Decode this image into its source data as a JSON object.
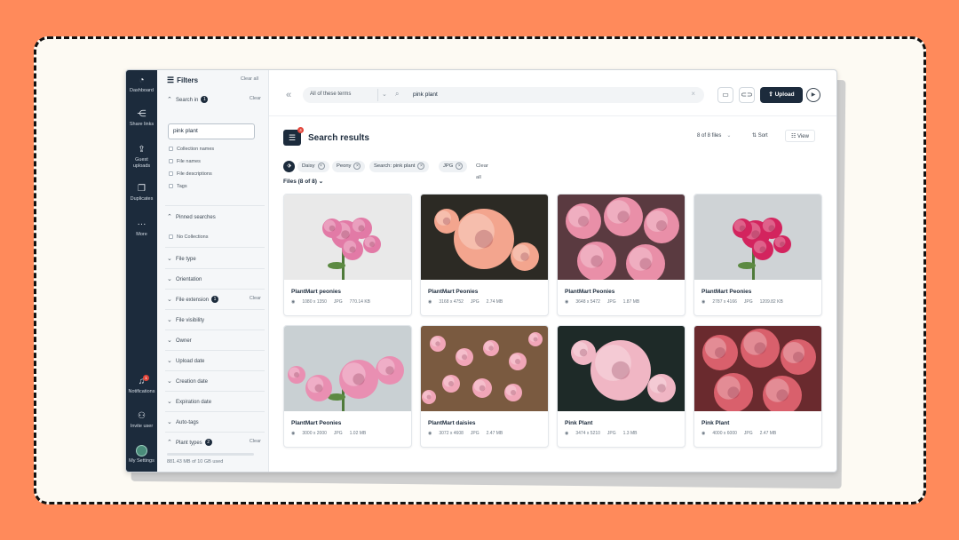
{
  "rail": [
    {
      "label": "Dashboard",
      "icon": "dashboard-icon",
      "glyph": "◔"
    },
    {
      "label": "Share links",
      "icon": "share-icon",
      "glyph": "⋲"
    },
    {
      "label": "Guest uploads",
      "icon": "upload-icon",
      "glyph": "⇪"
    },
    {
      "label": "Duplicates",
      "icon": "duplicates-icon",
      "glyph": "❐"
    },
    {
      "label": "More",
      "icon": "more-icon",
      "glyph": "···"
    },
    {
      "label": "Notifications",
      "icon": "bell-icon",
      "glyph": "♫",
      "badge": "1"
    },
    {
      "label": "Invite user",
      "icon": "invite-user-icon",
      "glyph": "⚇"
    },
    {
      "label": "My Settings",
      "icon": "avatar",
      "glyph": ""
    }
  ],
  "filters": {
    "title": "Filters",
    "clear_all": "Clear all",
    "search_in": {
      "label": "Search in",
      "count": "1",
      "clear": "Clear"
    },
    "query_value": "pink plant",
    "checkboxes": [
      "Collection names",
      "File names",
      "File descriptions",
      "Tags"
    ],
    "pinned": {
      "label": "Pinned searches",
      "value": "No Collections"
    },
    "sections": {
      "file_type": "File type",
      "orientation": "Orientation",
      "file_extension": {
        "label": "File extension",
        "count": "1",
        "clear": "Clear"
      },
      "file_visibility": "File visibility",
      "owner": "Owner",
      "upload_date": "Upload date",
      "creation_date": "Creation date",
      "expiration_date": "Expiration date",
      "auto_tags": "Auto-tags",
      "plant_types": {
        "label": "Plant types",
        "count": "2",
        "clear": "Clear"
      }
    },
    "storage": "881.43 MB of 10 GB used"
  },
  "topbar": {
    "scope": "All of these terms",
    "query": "pink plant",
    "upload": "Upload"
  },
  "results": {
    "title": "Search results",
    "badge": "4",
    "count": "8 of 8 files",
    "sort": "Sort",
    "view": "View",
    "chips": [
      "Daisy",
      "Peony",
      "Search: pink plant",
      "JPG"
    ],
    "clear_all": "Clear all",
    "files_label": "Files (8 of 8)"
  },
  "files": [
    {
      "title": "PlantMart peonies",
      "dims": "1080 x 1350",
      "ext": "JPG",
      "size": "770.14 KB",
      "bg": "#e9e9e9",
      "flower": "#e27aa6",
      "kind": "light"
    },
    {
      "title": "PlantMart Peonies",
      "dims": "3168 x 4752",
      "ext": "JPG",
      "size": "2.74 MB",
      "bg": "#2c2a24",
      "flower": "#f3a58e",
      "kind": "dark"
    },
    {
      "title": "PlantMart Peonies",
      "dims": "3648 x 5472",
      "ext": "JPG",
      "size": "1.87 MB",
      "bg": "#5a3a40",
      "flower": "#e98fa8",
      "kind": "cluster"
    },
    {
      "title": "PlantMart Peonies",
      "dims": "2787 x 4166",
      "ext": "JPG",
      "size": "1209.82 KB",
      "bg": "#cfd3d6",
      "flower": "#d3245e",
      "kind": "light"
    },
    {
      "title": "PlantMart Peonies",
      "dims": "3000 x 2000",
      "ext": "JPG",
      "size": "1.02 MB",
      "bg": "#c9d0d3",
      "flower": "#e98fb2",
      "kind": "window"
    },
    {
      "title": "PlantMart daisies",
      "dims": "3072 x 4608",
      "ext": "JPG",
      "size": "2.47 MB",
      "bg": "#7a5a40",
      "flower": "#f1a6b8",
      "kind": "daisy"
    },
    {
      "title": "Pink Plant",
      "dims": "3474 x 5210",
      "ext": "JPG",
      "size": "1.3 MB",
      "bg": "#1e2a28",
      "flower": "#f0b6c4",
      "kind": "dark"
    },
    {
      "title": "Pink Plant",
      "dims": "4000 x 6000",
      "ext": "JPG",
      "size": "2.47 MB",
      "bg": "#6a2a2e",
      "flower": "#d9606c",
      "kind": "cluster"
    }
  ]
}
